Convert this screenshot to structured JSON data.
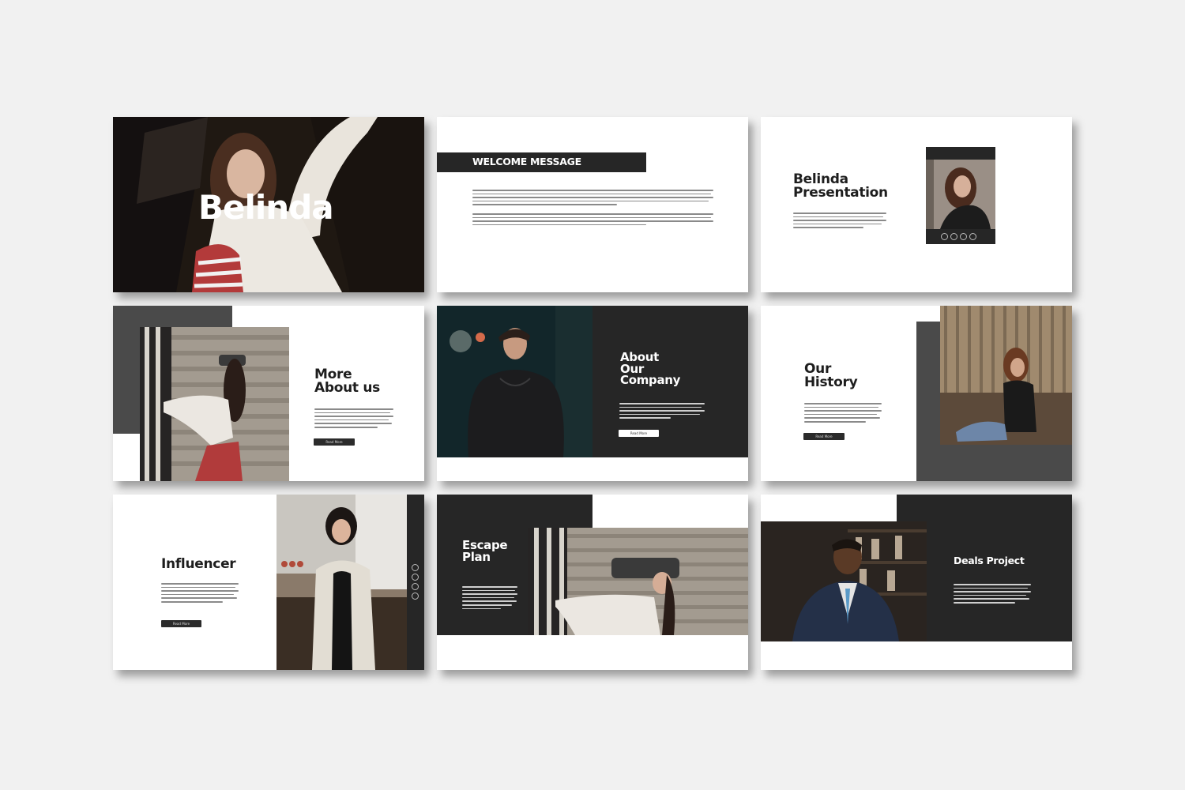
{
  "slides": {
    "s1": {
      "title": "Belinda"
    },
    "s2": {
      "title": "WELCOME MESSAGE"
    },
    "s3": {
      "title": "Belinda\nPresentation"
    },
    "s4": {
      "title": "More\nAbout us",
      "button": "Read More"
    },
    "s5": {
      "title": "About\nOur\nCompany",
      "button": "Read More"
    },
    "s6": {
      "title": "Our\nHistory",
      "button": "Read More"
    },
    "s7": {
      "title": "Influencer",
      "button": "Read More"
    },
    "s8": {
      "title": "Escape\nPlan"
    },
    "s9": {
      "title": "Deals Project"
    }
  },
  "colors": {
    "background": "#f1f1f1",
    "dark": "#262626",
    "gray": "#4a4a4a",
    "white": "#ffffff"
  }
}
